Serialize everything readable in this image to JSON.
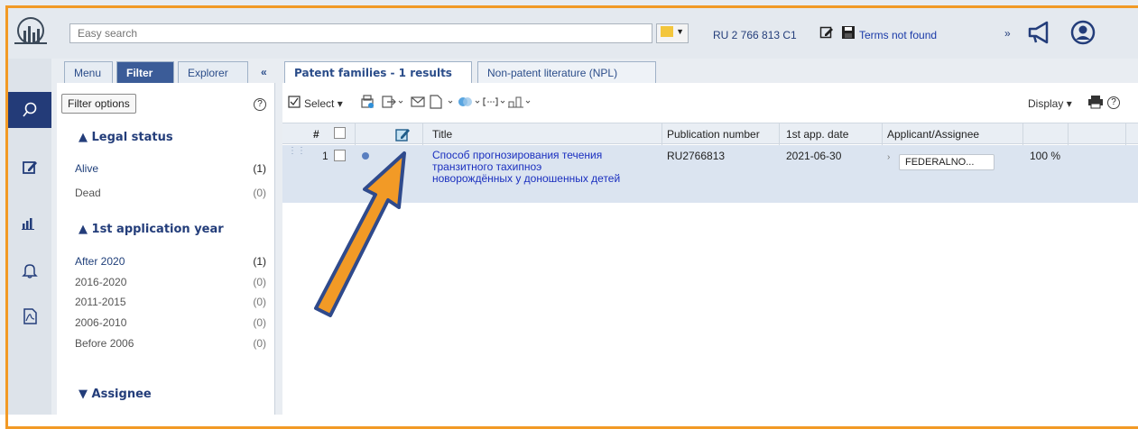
{
  "topbar": {
    "search_placeholder": "Easy search",
    "publication_ref": "RU 2 766 813 C1",
    "terms_status": "Terms not found",
    "more_symbol": "»"
  },
  "filter_tabs": [
    {
      "label": "Menu"
    },
    {
      "label": "Filter"
    },
    {
      "label": "Explorer"
    },
    {
      "label": "«"
    }
  ],
  "filter_panel": {
    "options_button": "Filter options",
    "help": "?",
    "sections": [
      {
        "title": "▲ Legal status",
        "rows": [
          {
            "label": "Alive",
            "count": "(1)"
          },
          {
            "label": "Dead",
            "count": "(0)"
          }
        ]
      },
      {
        "title": "▲ 1st application year",
        "rows": [
          {
            "label": "After 2020",
            "count": "(1)"
          },
          {
            "label": "2016-2020",
            "count": "(0)"
          },
          {
            "label": "2011-2015",
            "count": "(0)"
          },
          {
            "label": "2006-2010",
            "count": "(0)"
          },
          {
            "label": "Before 2006",
            "count": "(0)"
          }
        ]
      },
      {
        "title": "▼ Assignee",
        "rows": []
      }
    ]
  },
  "result_tabs": [
    {
      "label": "Patent families - 1 results"
    },
    {
      "label": "Non-patent literature (NPL)"
    }
  ],
  "toolbar": {
    "select_label": "Select",
    "display_label": "Display"
  },
  "table": {
    "columns": [
      "#",
      "Title",
      "Publication number",
      "1st app. date",
      "Applicant/Assignee"
    ],
    "rows": [
      {
        "index": "1",
        "title_lines": [
          "Способ прогнозирования течения",
          "транзитного тахипноэ",
          "новорождённых у доношенных детей"
        ],
        "publication_number": "RU2766813",
        "app_date": "2021-06-30",
        "assignee": "FEDERALNO...",
        "relevance": "100 %"
      }
    ]
  },
  "colors": {
    "accent_navy": "#233b78",
    "link_blue": "#1a2fbf",
    "annotation_orange": "#f29a26",
    "row_highlight": "#dbe4f0"
  }
}
